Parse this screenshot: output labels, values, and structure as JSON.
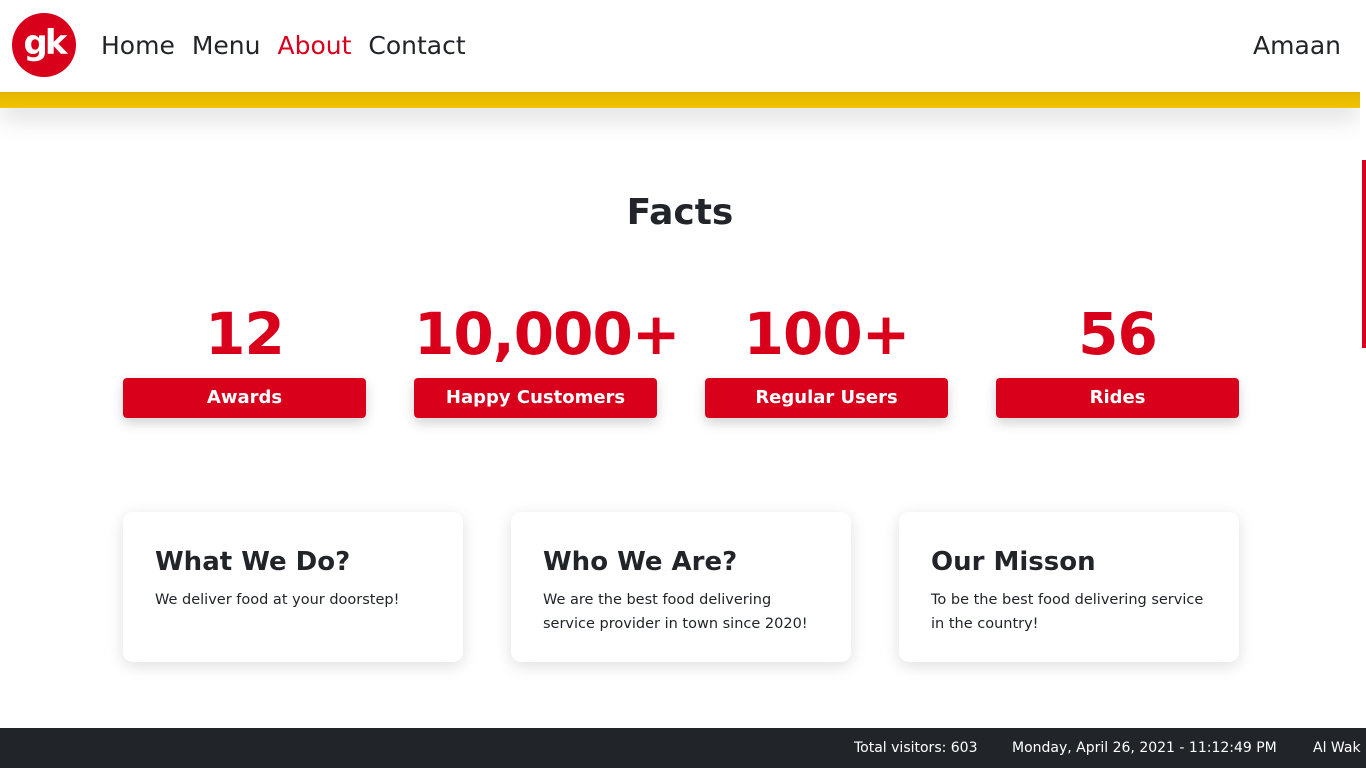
{
  "header": {
    "logo_text": "gk",
    "nav": [
      {
        "label": "Home",
        "active": false
      },
      {
        "label": "Menu",
        "active": false
      },
      {
        "label": "About",
        "active": true
      },
      {
        "label": "Contact",
        "active": false
      }
    ],
    "user_name": "Amaan"
  },
  "facts": {
    "title": "Facts",
    "items": [
      {
        "value": "12",
        "label": "Awards"
      },
      {
        "value": "10,000+",
        "label": "Happy Customers"
      },
      {
        "value": "100+",
        "label": "Regular Users"
      },
      {
        "value": "56",
        "label": "Rides"
      }
    ]
  },
  "cards": [
    {
      "title": "What We Do?",
      "text": "We deliver food at your doorstep!"
    },
    {
      "title": "Who We Are?",
      "text": "We are the best food delivering service provider in town since 2020!"
    },
    {
      "title": "Our Misson",
      "text": "To be the best food delivering service in the country!"
    }
  ],
  "footer": {
    "visitors": "Total visitors: 603",
    "datetime": "Monday, April 26, 2021 - 11:12:49 PM",
    "ticker": "Al Wak"
  },
  "colors": {
    "accent": "#d9001c",
    "hero_yellow": "#f0c200",
    "footer_bg": "#212529",
    "text": "#212529"
  }
}
